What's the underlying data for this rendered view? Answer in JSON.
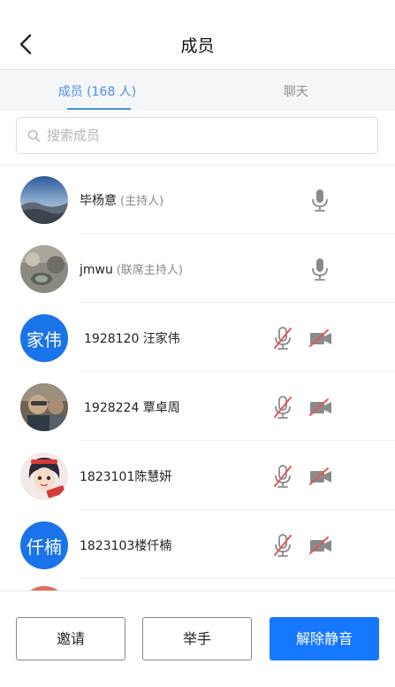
{
  "header": {
    "title": "成员"
  },
  "tabs": [
    {
      "label": "成员 (168 人)"
    },
    {
      "label": "聊天"
    }
  ],
  "search": {
    "placeholder": "搜索成员"
  },
  "members": [
    {
      "name": "毕杨意",
      "role": "(主持人)",
      "mic": "on",
      "camera": "none"
    },
    {
      "name": "jmwu",
      "role": "(联席主持人)",
      "mic": "on",
      "camera": "none"
    },
    {
      "name": "1928120 汪家伟",
      "avatar_text": "家伟",
      "mic": "muted",
      "camera": "off"
    },
    {
      "name": "1928224 覃卓周",
      "mic": "muted",
      "camera": "off"
    },
    {
      "name": "1823101陈慧妍",
      "mic": "muted",
      "camera": "off"
    },
    {
      "name": "1823103楼仟楠",
      "avatar_text": "仟楠",
      "mic": "muted",
      "camera": "off"
    }
  ],
  "footer": {
    "invite_label": "邀请",
    "raise_hand_label": "举手",
    "unmute_label": "解除静音"
  },
  "colors": {
    "accent": "#4a90e2",
    "primary_button": "#1677ff",
    "avatar_blue": "#1a73e8",
    "muted_red": "#e05a5a"
  }
}
